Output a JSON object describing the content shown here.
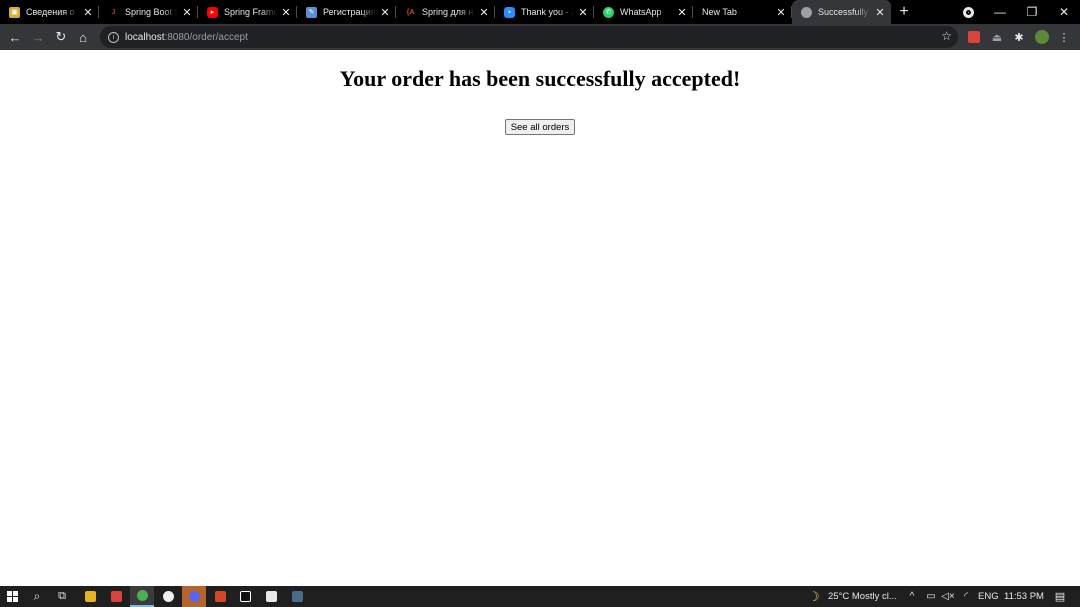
{
  "browser": {
    "tabs": [
      {
        "title": "Сведения о за",
        "favicon": "image-icon",
        "color": "#d4b12a"
      },
      {
        "title": "Spring Boot S",
        "favicon": "javarush-icon",
        "color": "#cc2a2a"
      },
      {
        "title": "Spring Framew",
        "favicon": "youtube-icon",
        "color": "#ff0000"
      },
      {
        "title": "Регистрация и",
        "favicon": "feather-icon",
        "color": "#5b8fd6"
      },
      {
        "title": "Spring для на",
        "favicon": "spring-icon",
        "color": "#d9443a"
      },
      {
        "title": "Thank you - Zo",
        "favicon": "zoom-icon",
        "color": "#2d8cff"
      },
      {
        "title": "WhatsApp",
        "favicon": "whatsapp-icon",
        "color": "#25d366"
      },
      {
        "title": "New Tab",
        "favicon": "",
        "color": ""
      },
      {
        "title": "Successfully ac",
        "favicon": "globe-icon",
        "color": "#9aa0a6"
      }
    ],
    "new_tab_glyph": "+",
    "url_host": "localhost",
    "url_path": ":8080/order/accept"
  },
  "page": {
    "heading": "Your order has been successfully accepted!",
    "button_label": "See all orders"
  },
  "taskbar": {
    "weather": "25°C  Mostly cl...",
    "language": "ENG",
    "time": "11:53 PM"
  },
  "colors": {
    "tabstrip": "#000000",
    "toolbar": "#35363a",
    "omnibox": "#202124",
    "taskbar": "#1f1f1f"
  }
}
